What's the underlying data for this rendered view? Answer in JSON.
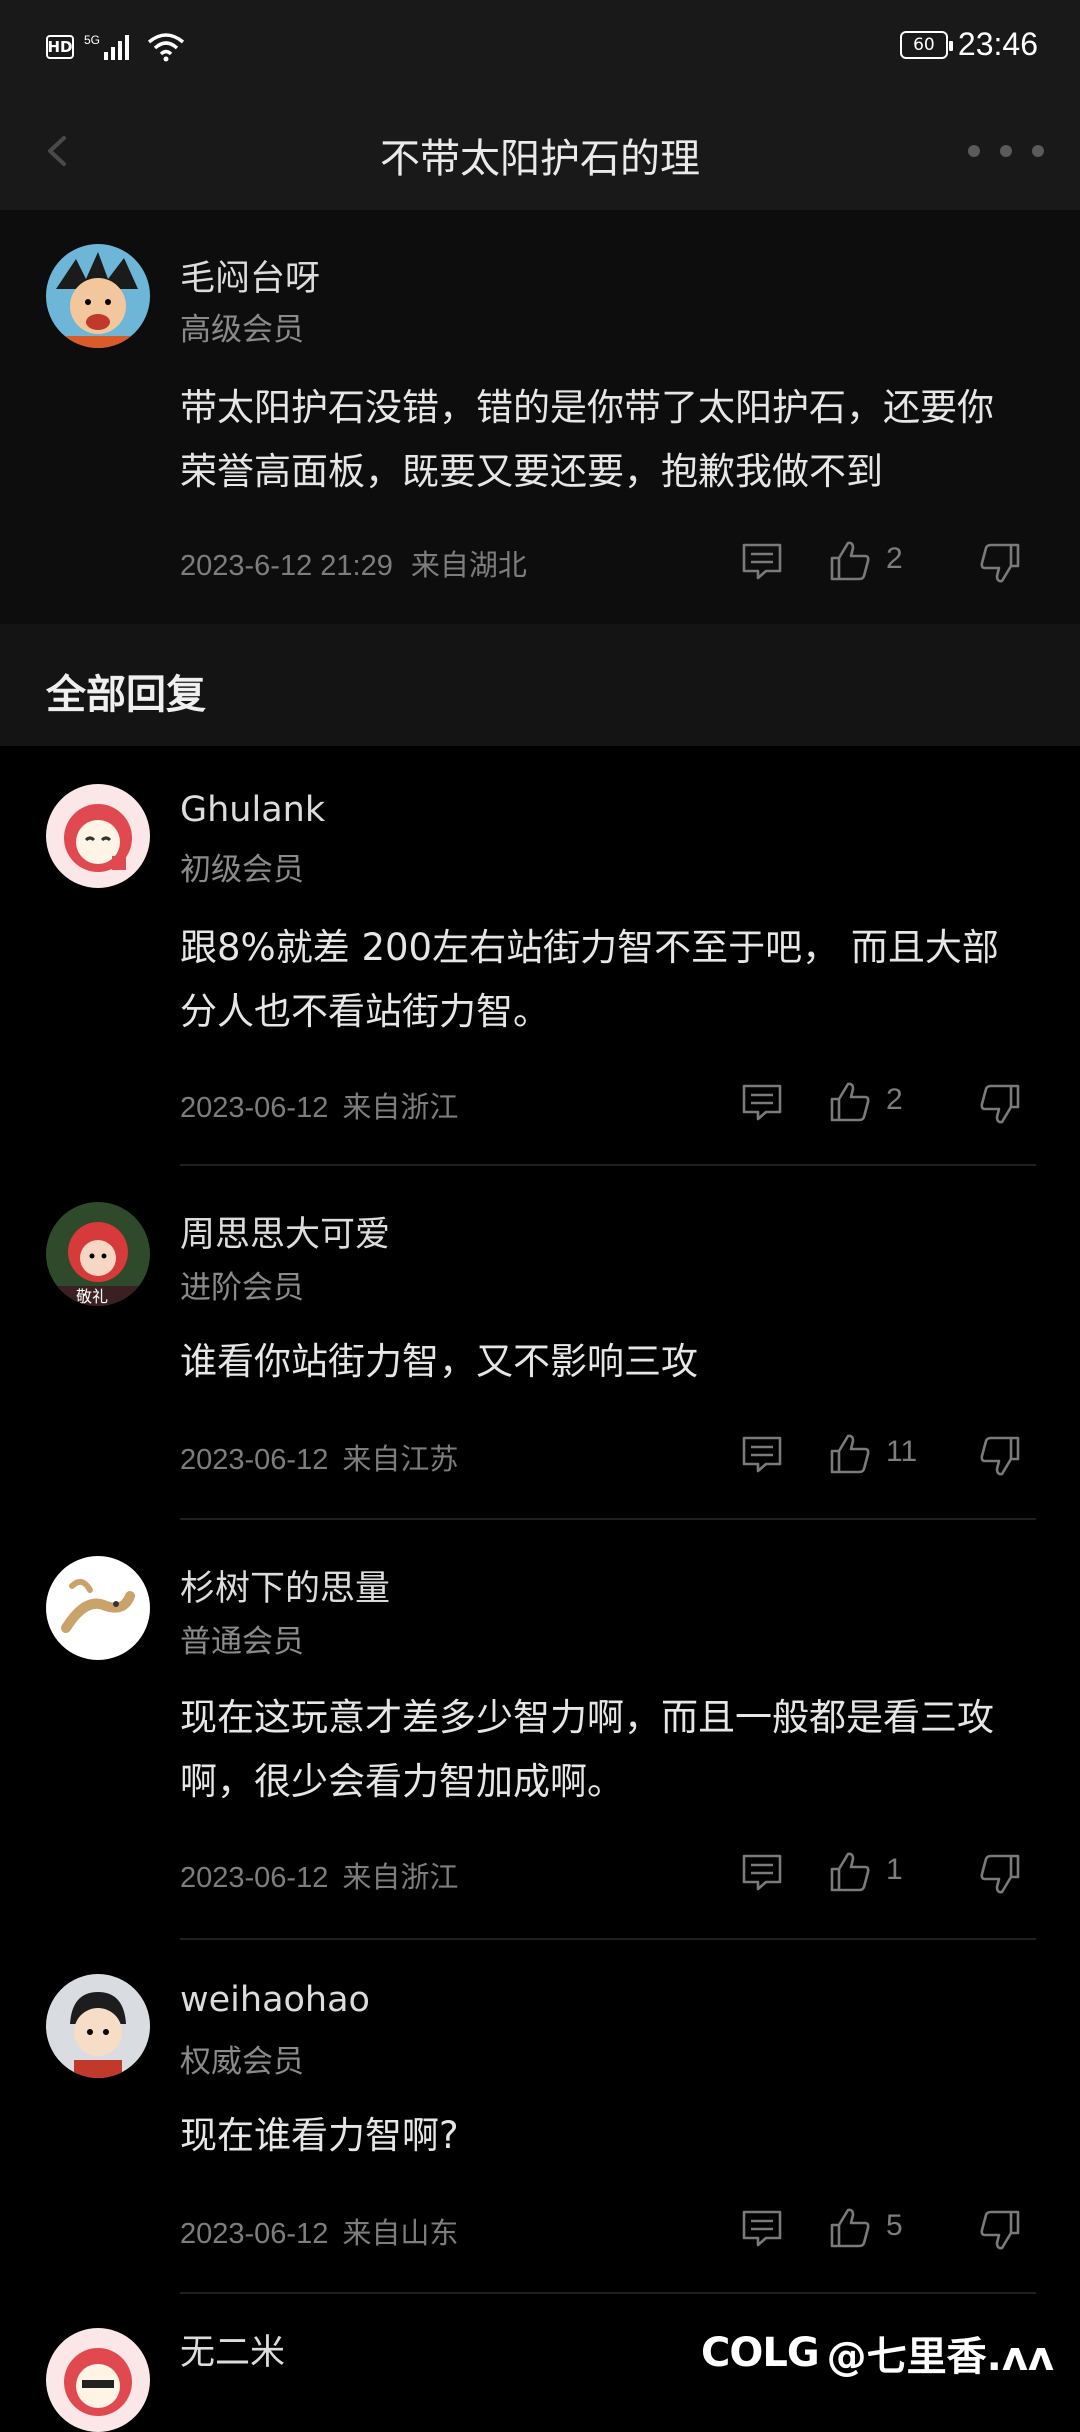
{
  "status_bar": {
    "hd": "HD",
    "network": "5G",
    "battery": "60",
    "time": "23:46"
  },
  "header": {
    "title": "不带太阳护石的理"
  },
  "post": {
    "username": "毛闷台呀",
    "level": "高级会员",
    "content": "带太阳护石没错，错的是你带了太阳护石，还要你荣誉高面板，既要又要还要，抱歉我做不到",
    "time": "2023-6-12 21:29",
    "location": "来自湖北",
    "likes": "2"
  },
  "section": {
    "title": "全部回复"
  },
  "comments": [
    {
      "username": "Ghulank",
      "level": "初级会员",
      "content": "跟8%就差 200左右站街力智不至于吧， 而且大部分人也不看站街力智。",
      "date": "2023-06-12",
      "location": "来自浙江",
      "likes": "2"
    },
    {
      "username": "周思思大可爱",
      "level": "进阶会员",
      "content": "谁看你站街力智，又不影响三攻",
      "date": "2023-06-12",
      "location": "来自江苏",
      "likes": "11"
    },
    {
      "username": "杉树下的思量",
      "level": "普通会员",
      "content": "现在这玩意才差多少智力啊，而且一般都是看三攻啊，很少会看力智加成啊。",
      "date": "2023-06-12",
      "location": "来自浙江",
      "likes": "1"
    },
    {
      "username": "weihaohao",
      "level": "权威会员",
      "content": "现在谁看力智啊?",
      "date": "2023-06-12",
      "location": "来自山东",
      "likes": "5"
    },
    {
      "username": "无二米",
      "level": ""
    }
  ],
  "watermark": {
    "logo": "COLG",
    "text": "@七里香.ʌʌ"
  },
  "colors": {
    "background": "#000000",
    "bar": "#191919",
    "text": "#e6e6e6",
    "muted": "#7d7d7d"
  }
}
